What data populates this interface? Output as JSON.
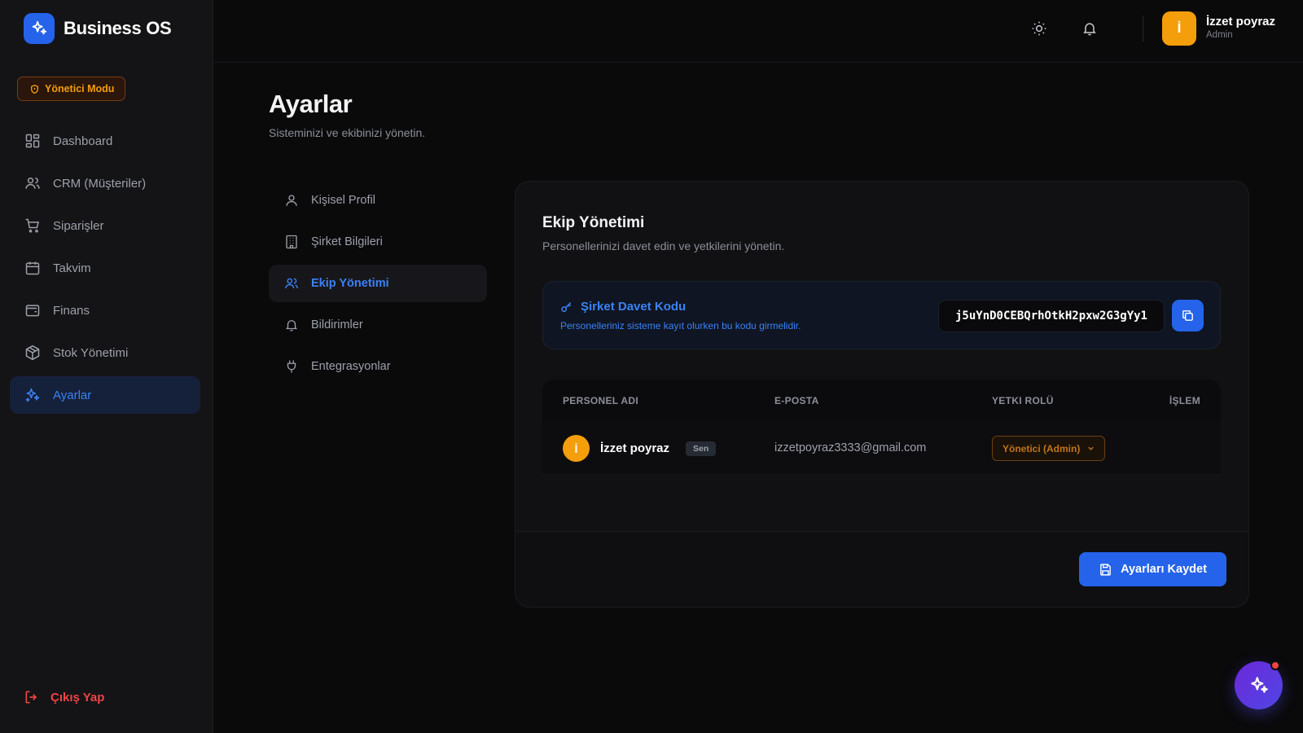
{
  "brand": {
    "name": "Business OS",
    "logo_icon": "sparkles-icon"
  },
  "mode_badge": {
    "label": "Yönetici Modu",
    "icon": "shield-icon"
  },
  "sidebar": {
    "items": [
      {
        "label": "Dashboard",
        "icon": "grid-icon",
        "active": false
      },
      {
        "label": "CRM (Müşteriler)",
        "icon": "users-icon",
        "active": false
      },
      {
        "label": "Siparişler",
        "icon": "cart-icon",
        "active": false
      },
      {
        "label": "Takvim",
        "icon": "calendar-icon",
        "active": false
      },
      {
        "label": "Finans",
        "icon": "wallet-icon",
        "active": false
      },
      {
        "label": "Stok Yönetimi",
        "icon": "box-icon",
        "active": false
      },
      {
        "label": "Ayarlar",
        "icon": "sparkles-icon",
        "active": true
      }
    ],
    "logout_label": "Çıkış Yap"
  },
  "header": {
    "user": {
      "initial": "İ",
      "name": "İzzet poyraz",
      "role": "Admin"
    }
  },
  "page": {
    "title": "Ayarlar",
    "subtitle": "Sisteminizi ve ekibinizi yönetin."
  },
  "settings_menu": {
    "items": [
      {
        "label": "Kişisel Profil",
        "icon": "user-icon",
        "active": false
      },
      {
        "label": "Şirket Bilgileri",
        "icon": "building-icon",
        "active": false
      },
      {
        "label": "Ekip Yönetimi",
        "icon": "users-icon",
        "active": true
      },
      {
        "label": "Bildirimler",
        "icon": "bell-icon",
        "active": false
      },
      {
        "label": "Entegrasyonlar",
        "icon": "plug-icon",
        "active": false
      }
    ]
  },
  "team": {
    "title": "Ekip Yönetimi",
    "subtitle": "Personellerinizi davet edin ve yetkilerini yönetin.",
    "invite": {
      "title": "Şirket Davet Kodu",
      "description": "Personelleriniz sisteme kayıt olurken bu kodu girmelidir.",
      "code": "j5uYnD0CEBQrhOtkH2pxw2G3gYy1"
    },
    "columns": [
      "PERSONEL ADI",
      "E-POSTA",
      "YETKI ROLÜ",
      "İŞLEM"
    ],
    "members": [
      {
        "initial": "İ",
        "name": "İzzet poyraz",
        "badge": "Sen",
        "email": "izzetpoyraz3333@gmail.com",
        "role": "Yönetici (Admin)"
      }
    ],
    "save_label": "Ayarları Kaydet"
  },
  "colors": {
    "accent": "#2563eb",
    "warning": "#f59e0b",
    "danger": "#ef4444",
    "fab": "#6d28d9"
  }
}
